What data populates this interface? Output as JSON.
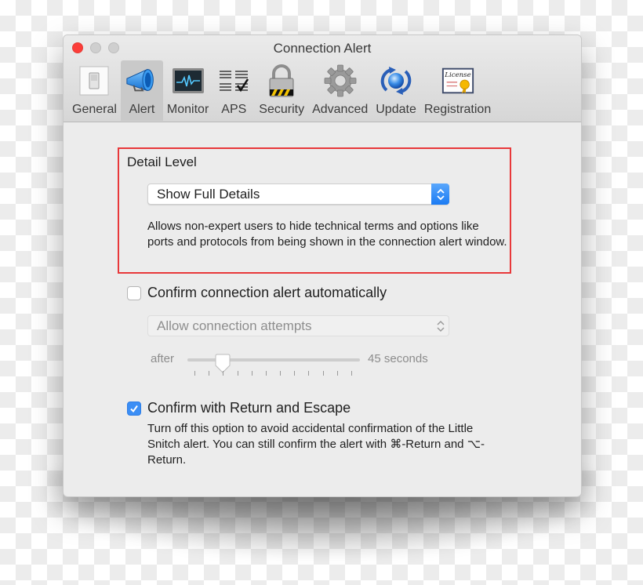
{
  "window": {
    "title": "Connection Alert",
    "controls": {
      "close": "close-button",
      "minimize": "minimize-button",
      "zoom": "zoom-button"
    }
  },
  "toolbar": {
    "selected": "alert",
    "items": [
      {
        "id": "general",
        "label": "General",
        "icon": "toggle-switch-icon"
      },
      {
        "id": "alert",
        "label": "Alert",
        "icon": "megaphone-icon"
      },
      {
        "id": "monitor",
        "label": "Monitor",
        "icon": "activity-monitor-icon"
      },
      {
        "id": "aps",
        "label": "APS",
        "icon": "checklist-icon"
      },
      {
        "id": "security",
        "label": "Security",
        "icon": "padlock-icon"
      },
      {
        "id": "advanced",
        "label": "Advanced",
        "icon": "gear-icon"
      },
      {
        "id": "update",
        "label": "Update",
        "icon": "refresh-globe-icon"
      },
      {
        "id": "registration",
        "label": "Registration",
        "icon": "license-certificate-icon"
      }
    ]
  },
  "detail_level": {
    "title": "Detail Level",
    "selected_option": "Show Full Details",
    "description": "Allows non-expert users to hide technical terms and options like ports and protocols from being shown in the connection alert window.",
    "highlight_color": "#e8383a"
  },
  "auto_confirm": {
    "label": "Confirm connection alert automatically",
    "checked": false,
    "action_option": "Allow connection attempts",
    "slider": {
      "prefix": "after",
      "value_text": "45 seconds",
      "tick_count": 12,
      "position_fraction": 0.18
    }
  },
  "return_escape": {
    "label": "Confirm with Return and Escape",
    "checked": true,
    "description": "Turn off this option to avoid accidental confirmation of the Little Snitch alert. You can still confirm the alert with ⌘-Return and ⌥-Return."
  },
  "colors": {
    "accent": "#3b8ef5",
    "close_button": "#fc3d39"
  }
}
